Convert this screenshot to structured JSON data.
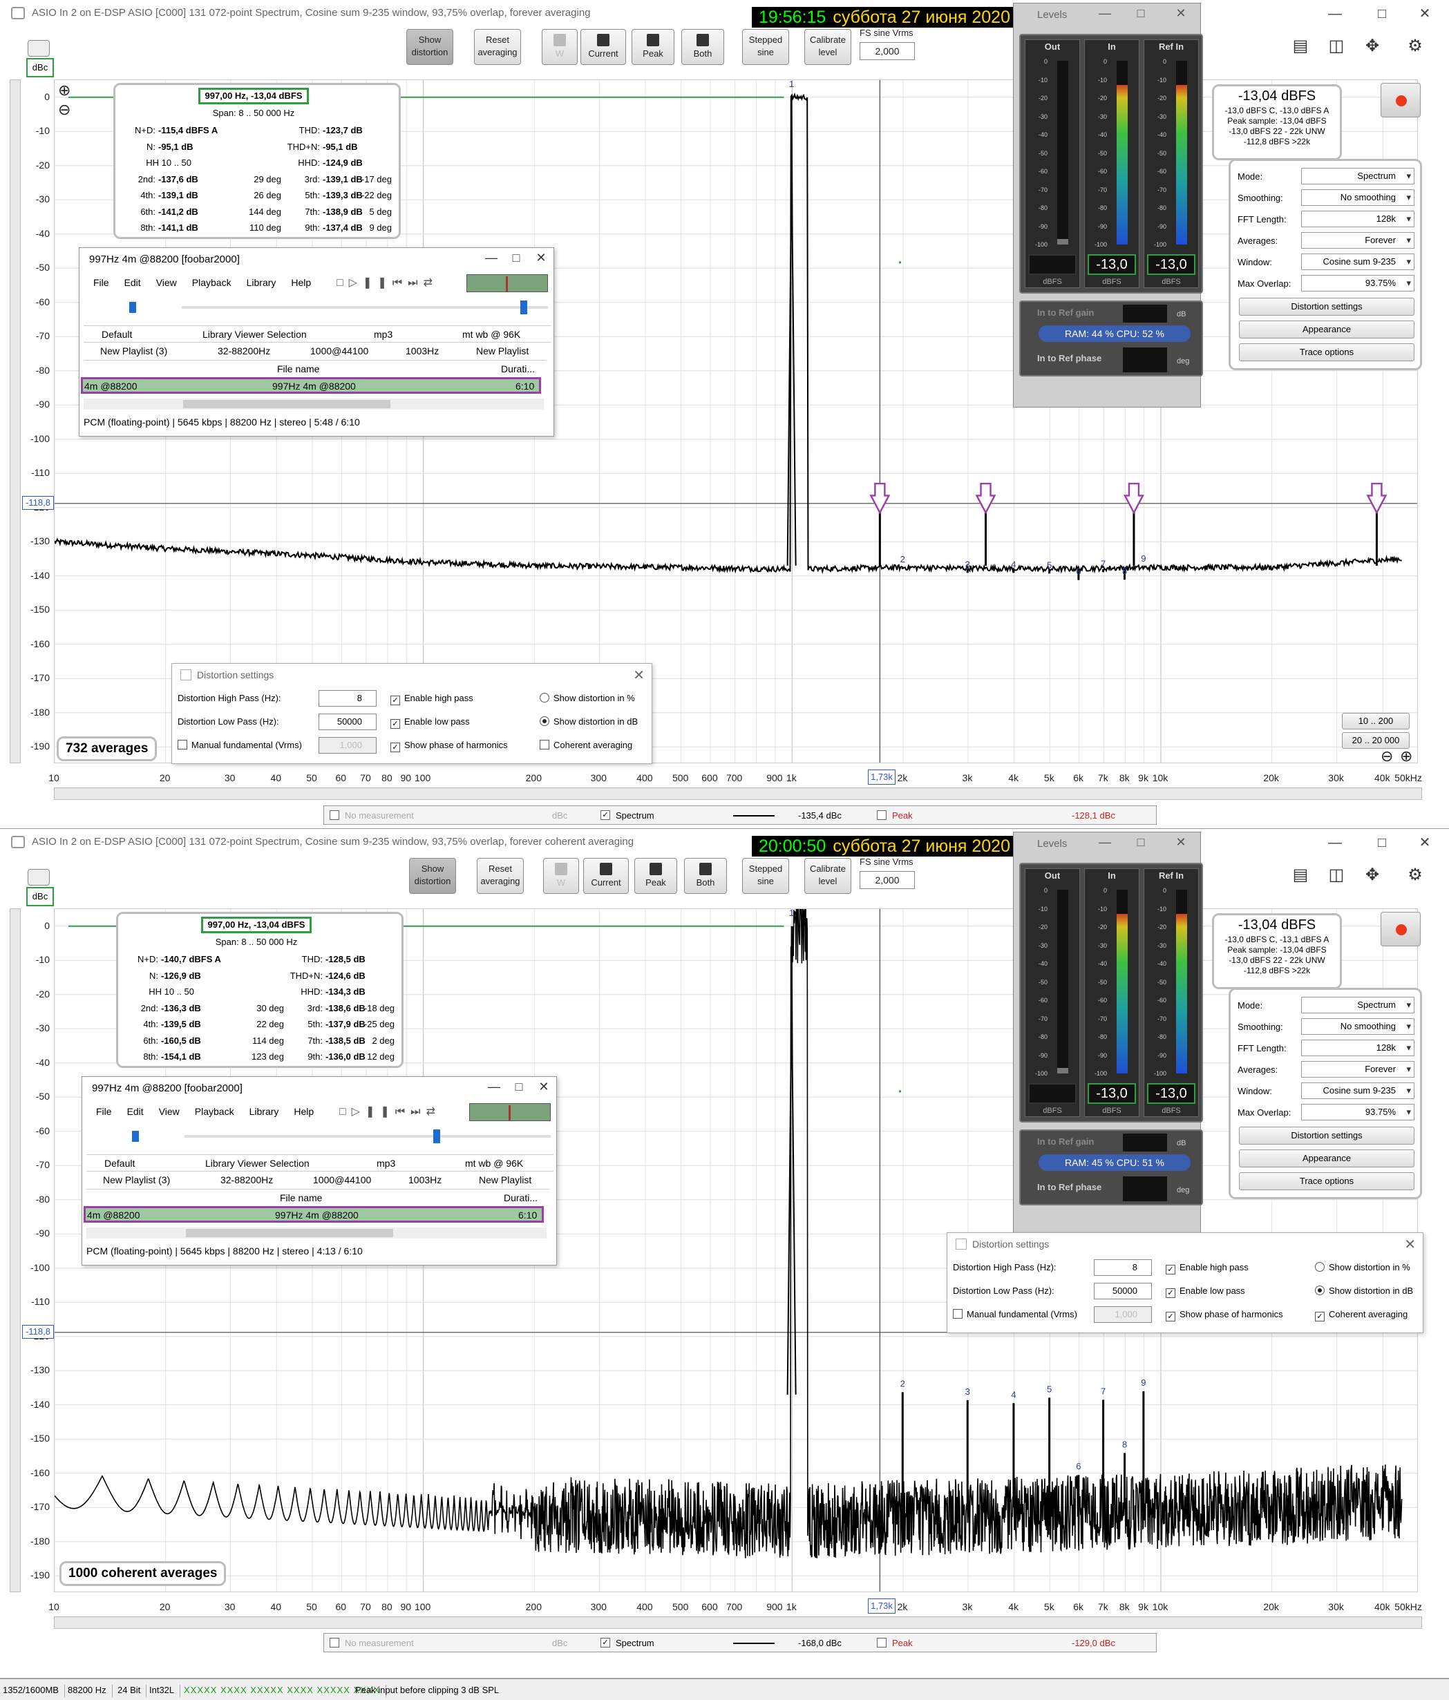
{
  "windows": [
    {
      "title": "ASIO In 2 on E-DSP ASIO [C000] 131 072-point Spectrum, Cosine sum 9-235 window, 93,75% overlap, forever averaging",
      "clock_time": "19:56:15",
      "clock_date": "суббота 27 июня 2020",
      "toolbar": {
        "show_distortion": "Show distortion",
        "reset_averaging": "Reset averaging",
        "w": "W",
        "current": "Current",
        "peak": "Peak",
        "both": "Both",
        "stepped_sine": "Stepped sine",
        "calibrate_level": "Calibrate level",
        "fs_label": "FS sine Vrms",
        "fs_value": "2,000"
      },
      "unit_box": "dBc",
      "unit_select": "dBc",
      "marker_y": "-118,8",
      "marker_x": "1,73k",
      "y_ticks": [
        "0",
        "-10",
        "-20",
        "-30",
        "-40",
        "-50",
        "-60",
        "-70",
        "-80",
        "-90",
        "-100",
        "-110",
        "-120",
        "-130",
        "-140",
        "-150",
        "-160",
        "-170",
        "-180",
        "-190"
      ],
      "x_ticks": [
        "10",
        "20",
        "30",
        "40",
        "50",
        "60",
        "70",
        "80",
        "90",
        "100",
        "200",
        "300",
        "400",
        "500",
        "600",
        "700",
        "900",
        "1k",
        "2k",
        "3k",
        "4k",
        "5k",
        "6k",
        "7k",
        "8k",
        "9k",
        "10k",
        "20k",
        "30k",
        "40k",
        "50kHz"
      ],
      "distortion": {
        "header": "997,00 Hz, -13,04 dBFS",
        "span": "Span: 8 .. 50 000 Hz",
        "rows": [
          [
            "N+D:",
            "-115,4 dBFS A",
            "",
            "THD:",
            "-123,7 dB",
            ""
          ],
          [
            "N:",
            "-95,1 dB",
            "",
            "THD+N:",
            "-95,1 dB",
            ""
          ],
          [
            "HH 10 .. 50",
            "",
            "",
            "HHD:",
            "-124,9 dB",
            ""
          ],
          [
            "2nd:",
            "-137,6 dB",
            "29 deg",
            "3rd:",
            "-139,1 dB",
            "-17 deg"
          ],
          [
            "4th:",
            "-139,1 dB",
            "26 deg",
            "5th:",
            "-139,3 dB",
            "-22 deg"
          ],
          [
            "6th:",
            "-141,2 dB",
            "144 deg",
            "7th:",
            "-138,9 dB",
            "5 deg"
          ],
          [
            "8th:",
            "-141,1 dB",
            "110 deg",
            "9th:",
            "-137,4 dB",
            "9 deg"
          ]
        ]
      },
      "foobar": {
        "title": "997Hz 4m @88200  [foobar2000]",
        "menu": [
          "File",
          "Edit",
          "View",
          "Playback",
          "Library",
          "Help"
        ],
        "tabs1": [
          "Default",
          "Library Viewer Selection",
          "mp3",
          "mt wb @ 96K"
        ],
        "tabs2": [
          "New Playlist (3)",
          "32-88200Hz",
          "1000@44100",
          "1003Hz",
          "New Playlist"
        ],
        "col_file": "File name",
        "col_dur": "Durati...",
        "row_left": "4m @88200",
        "row_file": "997Hz 4m @88200",
        "row_dur": "6:10",
        "status": "PCM (floating-point) | 5645 kbps | 88200 Hz | stereo | 5:48 / 6:10"
      },
      "levels": {
        "title": "Levels",
        "out_label": "Out",
        "in_label": "In",
        "ref_label": "Ref In",
        "in_value": "-13,0",
        "ref_value": "-13,0",
        "unit": "dBFS",
        "meter_scale": [
          "0",
          "-10",
          "-20",
          "-30",
          "-40",
          "-50",
          "-60",
          "-70",
          "-80",
          "-90",
          "-100"
        ],
        "in_fill": 0.87,
        "ref_fill": 0.87,
        "out_fill": 0.03,
        "ref_gain": "In to Ref gain",
        "ram": "RAM: 44 %  CPU: 52 %",
        "ref_phase": "In to Ref phase",
        "deg": "deg",
        "db": "dB"
      },
      "readout": {
        "big": "-13,04 dBFS",
        "l1": "-13,0 dBFS C, -13,0 dBFS A",
        "l2": "Peak sample: -13,04 dBFS",
        "l3": "-13,0 dBFS 22 - 22k UNW",
        "l4": "-112,8 dBFS >22k"
      },
      "controls": {
        "mode_k": "Mode:",
        "mode_v": "Spectrum",
        "smooth_k": "Smoothing:",
        "smooth_v": "No smoothing",
        "fft_k": "FFT Length:",
        "fft_v": "128k",
        "avg_k": "Averages:",
        "avg_v": "Forever",
        "win_k": "Window:",
        "win_v": "Cosine sum 9-235",
        "ovl_k": "Max Overlap:",
        "ovl_v": "93.75%",
        "b1": "Distortion settings",
        "b2": "Appearance",
        "b3": "Trace options"
      },
      "averages": "732 averages",
      "zoom1": "10 .. 200",
      "zoom2": "20 .. 20 000",
      "dsettings": {
        "title": "Distortion settings",
        "hp_label": "Distortion High Pass (Hz):",
        "hp_value": "8",
        "lp_label": "Distortion Low Pass (Hz):",
        "lp_value": "50000",
        "mf_label": "Manual fundamental (Vrms)",
        "mf_value": "1,000",
        "enable_hp": "Enable high pass",
        "enable_lp": "Enable low pass",
        "show_phase": "Show phase of harmonics",
        "pct": "Show distortion in %",
        "db": "Show distortion in dB",
        "coherent": "Coherent averaging",
        "coherent_checked": false
      },
      "legend": {
        "no_meas": "No measurement",
        "dbc": "dBc",
        "spectrum": "Spectrum",
        "spectrum_val": "-135,4 dBc",
        "peak": "Peak",
        "peak_val": "-128,1 dBc"
      },
      "harmonic_labels": [
        "1",
        "2",
        "3",
        "4",
        "5",
        "6",
        "7",
        "8",
        "9"
      ]
    },
    {
      "title": "ASIO In 2 on E-DSP ASIO [C000] 131 072-point Spectrum, Cosine sum 9-235 window, 93,75% overlap, forever coherent averaging",
      "clock_time": "20:00:50",
      "clock_date": "суббота 27 июня 2020",
      "toolbar": {
        "show_distortion": "Show distortion",
        "reset_averaging": "Reset averaging",
        "w": "W",
        "current": "Current",
        "peak": "Peak",
        "both": "Both",
        "stepped_sine": "Stepped sine",
        "calibrate_level": "Calibrate level",
        "fs_label": "FS sine Vrms",
        "fs_value": "2,000"
      },
      "unit_box": "dBc",
      "marker_y": "-118,8",
      "marker_x": "1,73k",
      "y_ticks": [
        "0",
        "-10",
        "-20",
        "-30",
        "-40",
        "-50",
        "-60",
        "-70",
        "-80",
        "-90",
        "-100",
        "-110",
        "-120",
        "-130",
        "-140",
        "-150",
        "-160",
        "-170",
        "-180",
        "-190"
      ],
      "x_ticks": [
        "10",
        "20",
        "30",
        "40",
        "50",
        "60",
        "70",
        "80",
        "90",
        "100",
        "200",
        "300",
        "400",
        "500",
        "600",
        "700",
        "900",
        "1k",
        "2k",
        "3k",
        "4k",
        "5k",
        "6k",
        "7k",
        "8k",
        "9k",
        "10k",
        "20k",
        "30k",
        "40k",
        "50kHz"
      ],
      "distortion": {
        "header": "997,00 Hz, -13,04 dBFS",
        "span": "Span: 8 .. 50 000 Hz",
        "rows": [
          [
            "N+D:",
            "-140,7 dBFS A",
            "",
            "THD:",
            "-128,5 dB",
            ""
          ],
          [
            "N:",
            "-126,9 dB",
            "",
            "THD+N:",
            "-124,6 dB",
            ""
          ],
          [
            "HH 10 .. 50",
            "",
            "",
            "HHD:",
            "-134,3 dB",
            ""
          ],
          [
            "2nd:",
            "-136,3 dB",
            "30 deg",
            "3rd:",
            "-138,6 dB",
            "-18 deg"
          ],
          [
            "4th:",
            "-139,5 dB",
            "22 deg",
            "5th:",
            "-137,9 dB",
            "-25 deg"
          ],
          [
            "6th:",
            "-160,5 dB",
            "114 deg",
            "7th:",
            "-138,5 dB",
            "2 deg"
          ],
          [
            "8th:",
            "-154,1 dB",
            "123 deg",
            "9th:",
            "-136,0 dB",
            "12 deg"
          ]
        ]
      },
      "foobar": {
        "title": "997Hz 4m @88200  [foobar2000]",
        "menu": [
          "File",
          "Edit",
          "View",
          "Playback",
          "Library",
          "Help"
        ],
        "tabs1": [
          "Default",
          "Library Viewer Selection",
          "mp3",
          "mt wb @ 96K"
        ],
        "tabs2": [
          "New Playlist (3)",
          "32-88200Hz",
          "1000@44100",
          "1003Hz",
          "New Playlist"
        ],
        "col_file": "File name",
        "col_dur": "Durati...",
        "row_left": "4m @88200",
        "row_file": "997Hz 4m @88200",
        "row_dur": "6:10",
        "status": "PCM (floating-point) | 5645 kbps | 88200 Hz | stereo | 4:13 / 6:10"
      },
      "levels": {
        "title": "Levels",
        "out_label": "Out",
        "in_label": "In",
        "ref_label": "Ref In",
        "in_value": "-13,0",
        "ref_value": "-13,0",
        "unit": "dBFS",
        "meter_scale": [
          "0",
          "-10",
          "-20",
          "-30",
          "-40",
          "-50",
          "-60",
          "-70",
          "-80",
          "-90",
          "-100"
        ],
        "in_fill": 0.87,
        "ref_fill": 0.87,
        "out_fill": 0.03,
        "ref_gain": "In to Ref gain",
        "ram": "RAM: 45 %  CPU: 51 %",
        "ref_phase": "In to Ref phase",
        "deg": "deg",
        "db": "dB"
      },
      "readout": {
        "big": "-13,04 dBFS",
        "l1": "-13,0 dBFS C, -13,1 dBFS A",
        "l2": "Peak sample: -13,04 dBFS",
        "l3": "-13,0 dBFS 22 - 22k UNW",
        "l4": "-112,8 dBFS >22k"
      },
      "controls": {
        "mode_k": "Mode:",
        "mode_v": "Spectrum",
        "smooth_k": "Smoothing:",
        "smooth_v": "No smoothing",
        "fft_k": "FFT Length:",
        "fft_v": "128k",
        "avg_k": "Averages:",
        "avg_v": "Forever",
        "win_k": "Window:",
        "win_v": "Cosine sum 9-235",
        "ovl_k": "Max Overlap:",
        "ovl_v": "93.75%",
        "b1": "Distortion settings",
        "b2": "Appearance",
        "b3": "Trace options"
      },
      "averages": "1000 coherent averages",
      "dsettings": {
        "title": "Distortion settings",
        "hp_label": "Distortion High Pass (Hz):",
        "hp_value": "8",
        "lp_label": "Distortion Low Pass (Hz):",
        "lp_value": "50000",
        "mf_label": "Manual fundamental (Vrms)",
        "mf_value": "1,000",
        "enable_hp": "Enable high pass",
        "enable_lp": "Enable low pass",
        "show_phase": "Show phase of harmonics",
        "pct": "Show distortion in %",
        "db": "Show distortion in dB",
        "coherent": "Coherent averaging",
        "coherent_checked": true
      },
      "legend": {
        "no_meas": "No measurement",
        "dbc": "dBc",
        "spectrum": "Spectrum",
        "spectrum_val": "-168,0 dBc",
        "peak": "Peak",
        "peak_val": "-129,0 dBc"
      },
      "harmonic_labels": [
        "1",
        "2",
        "3",
        "4",
        "5",
        "6",
        "7",
        "8",
        "9"
      ]
    }
  ],
  "statusbar": {
    "mem": "1352/1600MB",
    "rate": "88200 Hz",
    "bits": "24 Bit",
    "fmt": "Int32L",
    "leds": "XXXXX XXXX  XXXXX XXXX  XXXXX XXXX",
    "msg": "Peak input before clipping 3 dB SPL"
  },
  "chart_data": [
    {
      "type": "line",
      "xlabel": "",
      "ylabel": "",
      "x_scale": "log",
      "xlim": [
        10,
        50000
      ],
      "ylim": [
        -195,
        5
      ],
      "grid": true,
      "series": [
        {
          "x": [
            10,
            20,
            50,
            100,
            200,
            500,
            900,
            997,
            1100,
            2000,
            5000,
            10000,
            20000,
            45000
          ],
          "y": [
            -130,
            -132,
            -134,
            -136,
            -137,
            -137.5,
            -138,
            0,
            -138,
            -137.5,
            -138,
            -137.5,
            -137.5,
            -135
          ]
        }
      ],
      "harmonics": [
        {
          "n": 2,
          "freq": 1994,
          "db": -137.6
        },
        {
          "n": 3,
          "freq": 2991,
          "db": -139.1
        },
        {
          "n": 4,
          "freq": 3988,
          "db": -139.1
        },
        {
          "n": 5,
          "freq": 4985,
          "db": -139.3
        },
        {
          "n": 6,
          "freq": 5982,
          "db": -141.2
        },
        {
          "n": 7,
          "freq": 6979,
          "db": -138.9
        },
        {
          "n": 8,
          "freq": 7976,
          "db": -141.1
        },
        {
          "n": 9,
          "freq": 8973,
          "db": -137.4
        }
      ],
      "spurs": [
        {
          "freq": 1730,
          "db": -118
        },
        {
          "freq": 3350,
          "db": -118
        },
        {
          "freq": 8450,
          "db": -118
        },
        {
          "freq": 38500,
          "db": -118
        }
      ]
    },
    {
      "type": "line",
      "xlabel": "",
      "ylabel": "",
      "x_scale": "log",
      "xlim": [
        10,
        50000
      ],
      "ylim": [
        -195,
        5
      ],
      "grid": true,
      "series": [
        {
          "x": [
            10,
            20,
            50,
            100,
            200,
            500,
            900,
            997,
            1100,
            2000,
            5000,
            10000,
            20000,
            45000
          ],
          "y": [
            -160,
            -165,
            -168,
            -170,
            -172,
            -173,
            -174,
            0,
            -174,
            -173,
            -172,
            -171,
            -170,
            -168
          ]
        }
      ],
      "harmonics": [
        {
          "n": 2,
          "freq": 1994,
          "db": -136.3
        },
        {
          "n": 3,
          "freq": 2991,
          "db": -138.6
        },
        {
          "n": 4,
          "freq": 3988,
          "db": -139.5
        },
        {
          "n": 5,
          "freq": 4985,
          "db": -137.9
        },
        {
          "n": 6,
          "freq": 5982,
          "db": -160.5
        },
        {
          "n": 7,
          "freq": 6979,
          "db": -138.5
        },
        {
          "n": 8,
          "freq": 7976,
          "db": -154.1
        },
        {
          "n": 9,
          "freq": 8973,
          "db": -136.0
        }
      ]
    }
  ]
}
